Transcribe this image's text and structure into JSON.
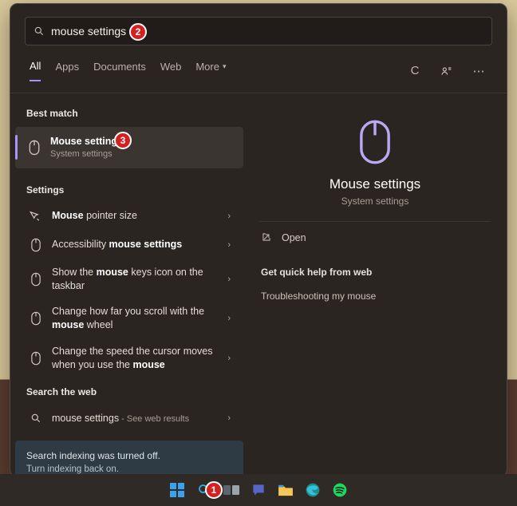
{
  "search": {
    "query": "mouse settings"
  },
  "filters": {
    "tabs": [
      "All",
      "Apps",
      "Documents",
      "Web"
    ],
    "more_label": "More"
  },
  "sections": {
    "best_match": "Best match",
    "settings": "Settings",
    "search_web": "Search the web"
  },
  "best": {
    "title": "Mouse settings",
    "subtitle": "System settings"
  },
  "settings_results": [
    {
      "title_pre": "",
      "title_bold": "Mouse",
      "title_post": " pointer size"
    },
    {
      "title_pre": "Accessibility ",
      "title_bold": "mouse settings",
      "title_post": ""
    },
    {
      "title_pre": "Show the ",
      "title_bold": "mouse",
      "title_post": " keys icon on the taskbar"
    },
    {
      "title_pre": "Change how far you scroll with the ",
      "title_bold": "mouse",
      "title_post": " wheel"
    },
    {
      "title_pre": "Change the speed the cursor moves when you use the ",
      "title_bold": "mouse",
      "title_post": ""
    }
  ],
  "web_result": {
    "term": "mouse settings",
    "suffix": " - See web results"
  },
  "notice": {
    "line1": "Search indexing was turned off.",
    "line2": "Turn indexing back on."
  },
  "preview": {
    "title": "Mouse settings",
    "subtitle": "System settings",
    "open": "Open",
    "help_header": "Get quick help from web",
    "help_link": "Troubleshooting my mouse"
  },
  "badges": {
    "b1": "1",
    "b2": "2",
    "b3": "3"
  }
}
